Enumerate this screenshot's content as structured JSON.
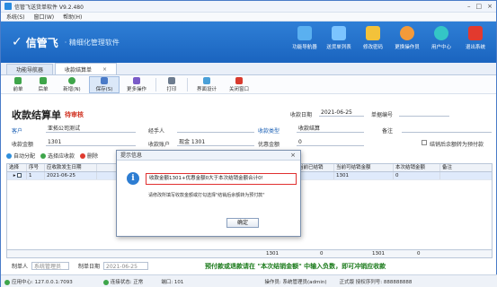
{
  "window": {
    "title": "信管飞送货单软件 V9.2.480"
  },
  "menu": [
    "系统(S)",
    "窗口(W)",
    "帮助(H)"
  ],
  "banner": {
    "logo_mark": "信管飞",
    "subtitle": "· 精细化管理软件"
  },
  "topnav": [
    {
      "label": "功能导航器",
      "color": "#5ab0f0",
      "icon": "monitor-icon"
    },
    {
      "label": "送货单列表",
      "color": "#7cc4ff",
      "icon": "list-icon"
    },
    {
      "label": "修改密码",
      "color": "#f3c23a",
      "icon": "lock-icon"
    },
    {
      "label": "更换操作员",
      "color": "#f39a3a",
      "icon": "user-icon"
    },
    {
      "label": "用户中心",
      "color": "#34c6c6",
      "icon": "globe-icon"
    },
    {
      "label": "退出系统",
      "color": "#e23a2e",
      "icon": "power-icon"
    }
  ],
  "tabs": [
    {
      "label": "功能导航器"
    },
    {
      "label": "收款结算单"
    }
  ],
  "toolbar": [
    "前单",
    "后单",
    "新增(N)",
    "保存(S)",
    "更多操作",
    "打印",
    "界面设计",
    "关闭窗口"
  ],
  "form": {
    "title": "收款结算单",
    "status": "待审核",
    "date_label": "收款日期",
    "date_value": "2021-06-25",
    "no_label": "单据编号",
    "customer_label": "客户",
    "customer_value": "亚拓公司测试",
    "handler_label": "经手人",
    "type_label": "收款类型",
    "type_value": "收款结算",
    "remark_label": "备注",
    "amount_label": "收款金额",
    "amount_value": "1301",
    "account_label": "收款账户",
    "account_value": "现金 1301",
    "discount_label": "优惠金额",
    "discount_value": "0",
    "prepay_label": "结销后余额转为预付款"
  },
  "subtoolbar": {
    "auto": "自动分配",
    "select": "选择应收款",
    "delete": "删除"
  },
  "grid": {
    "headers": [
      "选择",
      "序号",
      "应收款发生日期",
      "",
      "",
      "",
      "",
      "",
      "当前已结销",
      "当前可结销金额",
      "本次结销金额",
      "备注"
    ],
    "row": [
      "",
      "1",
      "2021-06-25",
      "",
      "",
      "",
      "",
      "",
      "",
      "1301",
      "0",
      ""
    ],
    "sum": {
      "a": "1301",
      "b": "0",
      "c": "1301",
      "d": "0"
    }
  },
  "footer": {
    "maker_label": "制单人",
    "maker_value": "系统管理员",
    "date_label": "制单日期",
    "date_value": "2021-06-25",
    "notice": "预付款或退款请在 \"本次结销金额\" 中输入负数，即可冲销应收款"
  },
  "status": {
    "app": "应用中心: 127.0.0.1:7093",
    "conn": "连接状态: 正常",
    "port": "端口: 101",
    "operator": "操作员: 系统管理员(admin)",
    "license": "正式版 授权序列号: 888888888"
  },
  "dialog": {
    "title": "提示信息",
    "message": "收款金额1301+优惠金额0大于本次结销金额合计0!",
    "hint": "请修改所填写收款金额或打勾选择\"结销后余额转为预付款\"",
    "ok": "确定"
  }
}
